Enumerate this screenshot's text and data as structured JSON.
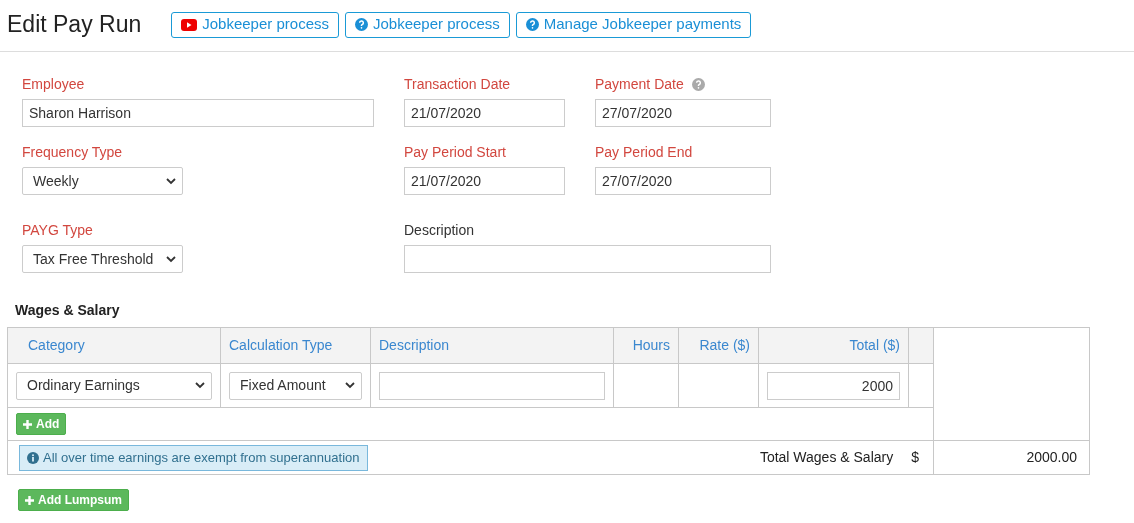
{
  "header": {
    "title": "Edit Pay Run",
    "buttons": [
      {
        "kind": "video",
        "label": "Jobkeeper process"
      },
      {
        "kind": "help",
        "label": "Jobkeeper process"
      },
      {
        "kind": "help",
        "label": "Manage Jobkeeper payments"
      }
    ]
  },
  "form": {
    "rows": [
      [
        {
          "kind": "text",
          "label": "Employee",
          "required": true,
          "help": false,
          "value": "Sharon Harrison"
        },
        {
          "kind": "text",
          "label": "Transaction Date",
          "required": true,
          "help": false,
          "value": "21/07/2020"
        },
        {
          "kind": "text",
          "label": "Payment Date",
          "required": true,
          "help": true,
          "value": "27/07/2020"
        }
      ],
      [
        {
          "kind": "select",
          "label": "Frequency Type",
          "required": true,
          "help": false,
          "value": "Weekly"
        },
        {
          "kind": "text",
          "label": "Pay Period Start",
          "required": true,
          "help": false,
          "value": "21/07/2020"
        },
        {
          "kind": "text",
          "label": "Pay Period End",
          "required": true,
          "help": false,
          "value": "27/07/2020"
        }
      ],
      [
        {
          "kind": "select",
          "label": "PAYG Type",
          "required": true,
          "help": false,
          "value": "Tax Free Threshold"
        },
        {
          "kind": "wide-text",
          "label": "Description",
          "required": false,
          "help": false
        }
      ]
    ]
  },
  "wages": {
    "title": "Wages & Salary",
    "columns": [
      {
        "label": "Category",
        "numeric": false
      },
      {
        "label": "Calculation Type",
        "numeric": false
      },
      {
        "label": "Description",
        "numeric": false
      },
      {
        "label": "Hours",
        "numeric": true
      },
      {
        "label": "Rate ($)",
        "numeric": true
      },
      {
        "label": "Total ($)",
        "numeric": true
      }
    ],
    "rows": [
      {
        "category": "Ordinary Earnings",
        "calculation_type": "Fixed Amount",
        "total": "2000"
      }
    ],
    "add_button": "Add",
    "note": "All over time earnings are exempt from superannuation",
    "total_label": "Total Wages & Salary",
    "currency": "$",
    "total_value": "2000.00"
  },
  "add_lumpsum_button": "Add Lumpsum"
}
